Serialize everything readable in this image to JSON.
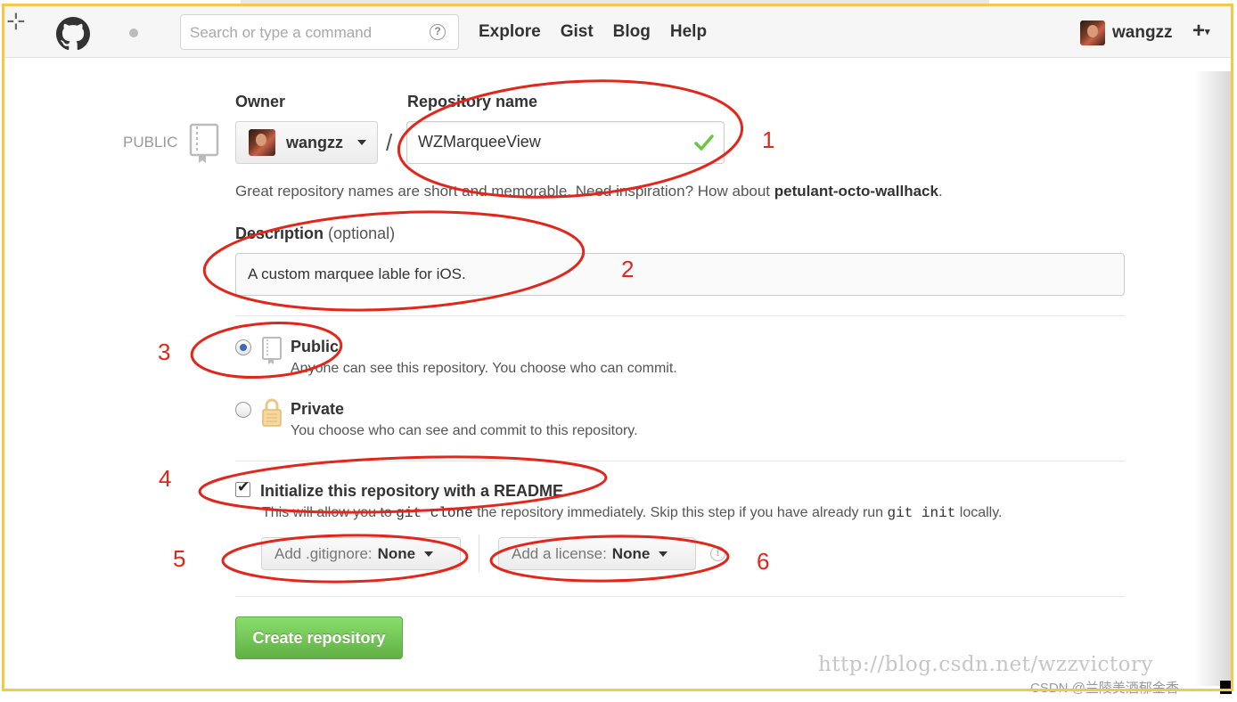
{
  "header": {
    "search_placeholder": "Search or type a command",
    "nav": [
      "Explore",
      "Gist",
      "Blog",
      "Help"
    ],
    "username": "wangzz",
    "plus_label": "+"
  },
  "form": {
    "visibility_tag": "PUBLIC",
    "owner_label": "Owner",
    "owner_value": "wangzz",
    "separator": "/",
    "repo_name_label": "Repository name",
    "repo_name_value": "WZMarqueeView",
    "hint_prefix": "Great repository names are short and memorable. Need inspiration? How about ",
    "hint_suggestion": "petulant-octo-wallhack",
    "hint_suffix": ".",
    "description_label": "Description",
    "description_optional": "(optional)",
    "description_value": "A custom marquee lable for iOS.",
    "public_title": "Public",
    "public_desc": "Anyone can see this repository. You choose who can commit.",
    "private_title": "Private",
    "private_desc": "You choose who can see and commit to this repository.",
    "init_readme_label": "Initialize this repository with a README",
    "init_desc_1": "This will allow you to ",
    "init_code_1": "git clone",
    "init_desc_2": " the repository immediately. Skip this step if you have already run ",
    "init_code_2": "git init",
    "init_desc_3": " locally.",
    "gitignore_label": "Add .gitignore:",
    "gitignore_value": "None",
    "license_label": "Add a license:",
    "license_value": "None",
    "create_button": "Create repository"
  },
  "annotations": [
    "1",
    "2",
    "3",
    "4",
    "5",
    "6"
  ],
  "watermark": "http://blog.csdn.net/wzzvictory",
  "credit": "CSDN @兰陵美酒郁金香",
  "colors": {
    "annotation_red": "#e1261c",
    "create_green": "#60b044",
    "frame_gold": "#f5c84c"
  },
  "icons": {
    "logo": "octocat-icon",
    "repo": "book-icon",
    "private": "lock-icon",
    "valid": "check-icon"
  }
}
